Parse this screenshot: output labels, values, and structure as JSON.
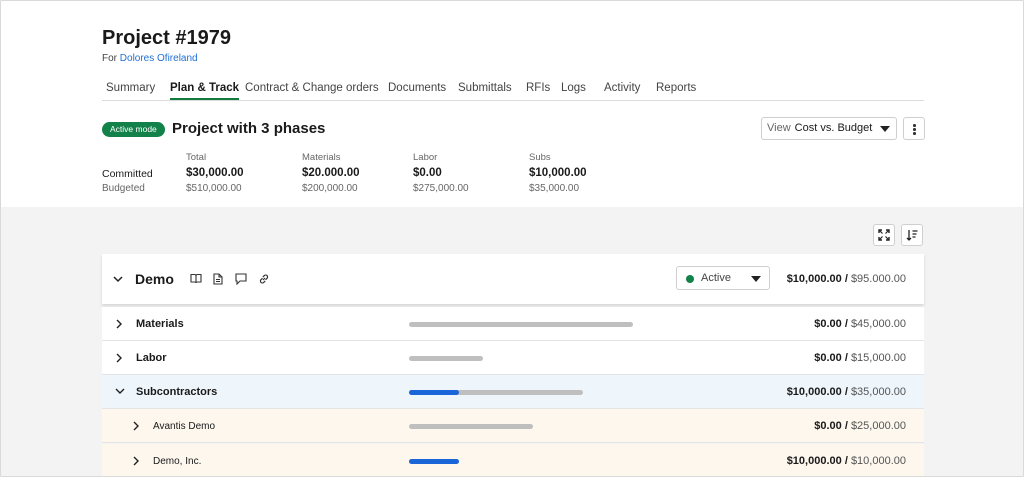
{
  "project": {
    "title": "Project #1979",
    "for_label": "For",
    "client": "Dolores Ofireland"
  },
  "tabs": [
    "Summary",
    "Plan & Track",
    "Contract & Change orders",
    "Documents",
    "Submittals",
    "RFIs",
    "Logs",
    "Activity",
    "Reports"
  ],
  "active_tab": "Plan & Track",
  "mode_badge": "Active mode",
  "phase_title": "Project with 3 phases",
  "view_select": {
    "label": "View",
    "value": "Cost vs. Budget"
  },
  "summary": {
    "row_labels": {
      "committed": "Committed",
      "budgeted": "Budgeted"
    },
    "columns": [
      {
        "name": "Total",
        "committed": "$30,000.00",
        "budgeted": "$510,000.00"
      },
      {
        "name": "Materials",
        "committed": "$20.000.00",
        "budgeted": "$200,000.00"
      },
      {
        "name": "Labor",
        "committed": "$0.00",
        "budgeted": "$275,000.00"
      },
      {
        "name": "Subs",
        "committed": "$10,000.00",
        "budgeted": "$35,000.00"
      }
    ]
  },
  "demo": {
    "name": "Demo",
    "status": "Active",
    "status_color": "#12824a",
    "committed": "$10,000.00",
    "separator": "/",
    "budgeted": "$95.000.00",
    "icons": [
      "book-icon",
      "document-icon",
      "comment-icon",
      "link-icon"
    ]
  },
  "lines": [
    {
      "name": "Materials",
      "committed": "$0.00",
      "budgeted": "$45,000.00",
      "progress": 0,
      "expanded": false,
      "level": 1
    },
    {
      "name": "Labor",
      "committed": "$0.00",
      "budgeted": "$15,000.00",
      "progress": 0,
      "expanded": false,
      "level": 1
    },
    {
      "name": "Subcontractors",
      "committed": "$10,000.00",
      "budgeted": "$35,000.00",
      "progress": 0.2857,
      "expanded": true,
      "level": 1
    },
    {
      "name": "Avantis Demo",
      "committed": "$0.00",
      "budgeted": "$25,000.00",
      "progress": 0,
      "expanded": false,
      "level": 2
    },
    {
      "name": "Demo, Inc.",
      "committed": "$10,000.00",
      "budgeted": "$10,000.00",
      "progress": 1,
      "expanded": false,
      "level": 2
    }
  ],
  "colors": {
    "accent_green": "#12824a",
    "progress_blue": "#1a66d9",
    "link_blue": "#1f6fd6",
    "track_gray": "#bfbfbf"
  }
}
